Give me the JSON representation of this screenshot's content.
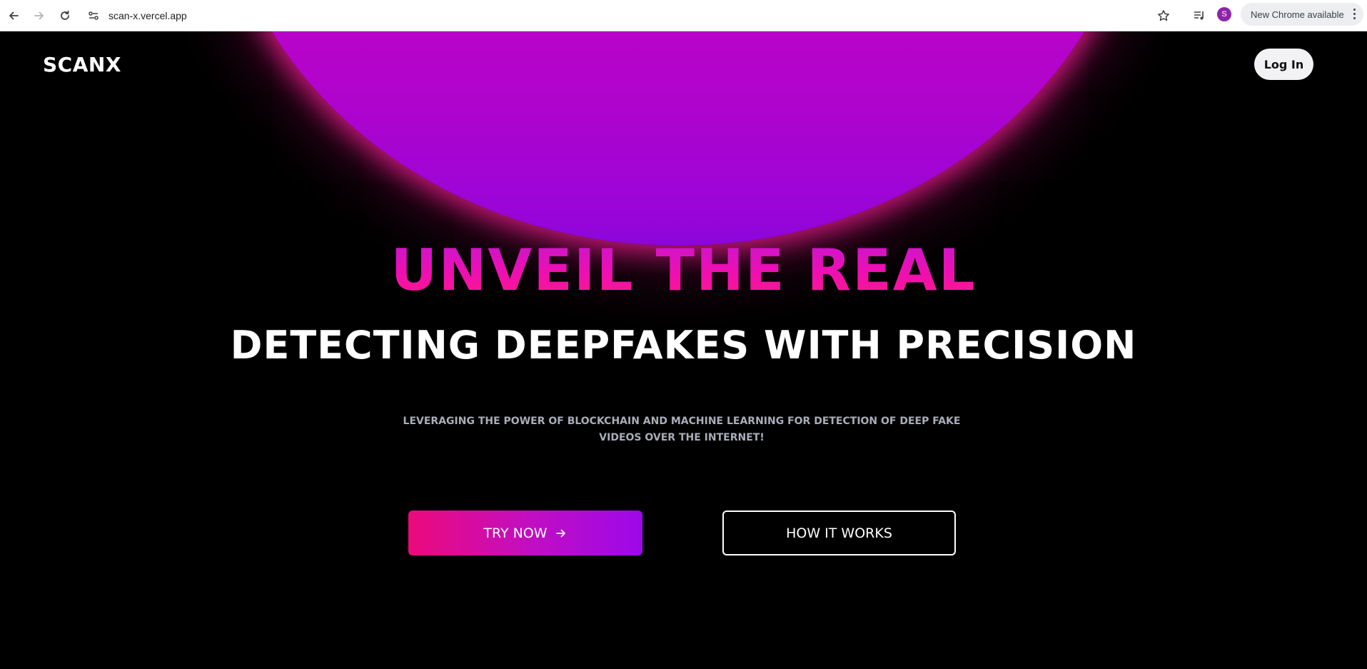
{
  "browser": {
    "url": "scan-x.vercel.app",
    "profile_initial": "S",
    "update_chip_label": "New Chrome available",
    "icons": [
      "back-arrow-icon",
      "forward-arrow-icon",
      "reload-icon",
      "site-info-icon",
      "bookmark-star-icon",
      "media-control-icon",
      "more-options-icon"
    ]
  },
  "header": {
    "logo": "SCANX",
    "login_label": "Log In"
  },
  "hero": {
    "headline": "UNVEIL THE REAL",
    "subheadline": "DETECTING DEEPFAKES WITH PRECISION",
    "description": "LEVERAGING THE POWER OF BLOCKCHAIN AND MACHINE LEARNING FOR DETECTION OF DEEP FAKE VIDEOS OVER THE INTERNET!",
    "try_label": "TRY NOW",
    "how_label": "HOW IT WORKS"
  },
  "colors": {
    "background": "#000000",
    "orb_top": "#e50ac6",
    "orb_bottom": "#8a06dc",
    "headline_pink": "#ff1a86",
    "button_gradient_start": "#ec0a7a",
    "button_gradient_end": "#9d08ea",
    "description_gray": "#a9adb8"
  }
}
